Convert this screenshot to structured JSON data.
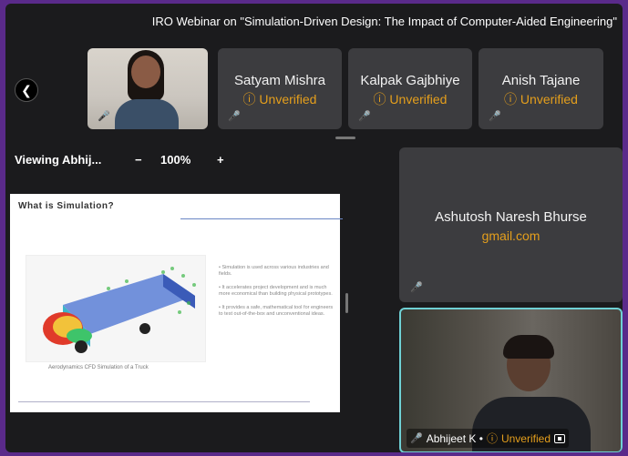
{
  "meeting": {
    "title": "IRO Webinar on \"Simulation-Driven Design: The Impact of Computer-Aided Engineering\""
  },
  "participants_strip": [
    {
      "name": "Satyam Mishra",
      "status": "Unverified"
    },
    {
      "name": "Kalpak Gajbhiye",
      "status": "Unverified"
    },
    {
      "name": "Anish Tajane",
      "status": "Unverified"
    }
  ],
  "viewer": {
    "viewing_label": "Viewing Abhij...",
    "zoom_out": "−",
    "zoom_level": "100%",
    "zoom_in": "+"
  },
  "slide": {
    "title": "What is Simulation?",
    "caption": "Aerodynamics CFD Simulation of a Truck",
    "bullets": [
      "Simulation is used across various industries and fields.",
      "It accelerates project development and is much more economical than building physical prototypes.",
      "It provides a safe, mathematical tool for engineers to test out-of-the-box and unconventional ideas."
    ]
  },
  "big_tile": {
    "name": "Ashutosh Naresh Bhurse",
    "email": "gmail.com"
  },
  "active_speaker": {
    "name": "Abhijeet K •",
    "status": "Unverified"
  },
  "colors": {
    "accent_orange": "#e59f1c",
    "active_border": "#6fd0d4",
    "outer_frame": "#5a2a8a"
  }
}
